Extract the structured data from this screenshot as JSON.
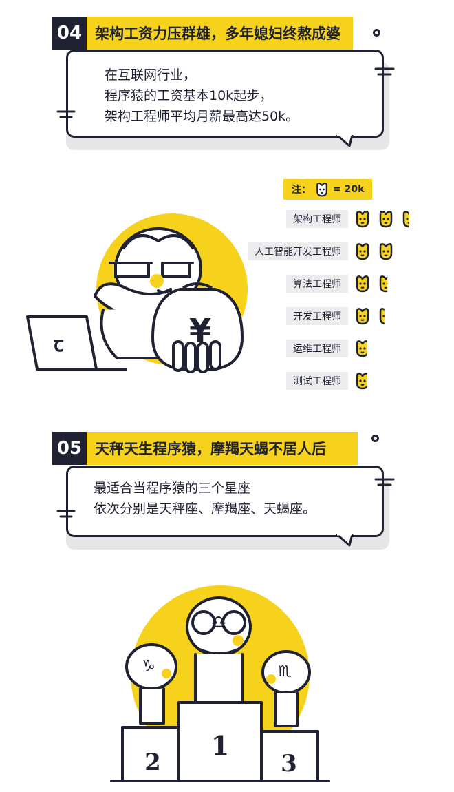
{
  "section4": {
    "number": "04",
    "title": "架构工资力压群雄，多年媳妇终熬成婆",
    "lines": [
      "在互联网行业，",
      "程序猿的工资基本10k起步，",
      "架构工程师平均月薪最高达50k。"
    ]
  },
  "legend": {
    "prefix": "注：",
    "equals": "= 20k"
  },
  "salary_chart": {
    "unit_value": "20k",
    "rows": [
      {
        "label": "架构工程师",
        "units": 2.5
      },
      {
        "label": "人工智能开发工程师",
        "units": 2
      },
      {
        "label": "算法工程师",
        "units": 1.6
      },
      {
        "label": "开发工程师",
        "units": 1.4
      },
      {
        "label": "运维工程师",
        "units": 0.8
      },
      {
        "label": "测试工程师",
        "units": 0.8
      }
    ]
  },
  "illustration1": {
    "laptop_logo": "ꞇ",
    "money_bag_symbol": "¥"
  },
  "section5": {
    "number": "05",
    "title": "天秤天生程序猿，摩羯天蝎不居人后",
    "lines": [
      "最适合当程序猿的三个星座",
      "依次分别是天秤座、摩羯座、天蝎座。"
    ]
  },
  "podium": {
    "first": "1",
    "second": "2",
    "third": "3",
    "first_sign": "♎",
    "second_sign": "♑",
    "third_sign": "♏"
  },
  "colors": {
    "accent": "#f7d21c",
    "ink": "#1f2233",
    "shadow": "#e6e6e9"
  }
}
